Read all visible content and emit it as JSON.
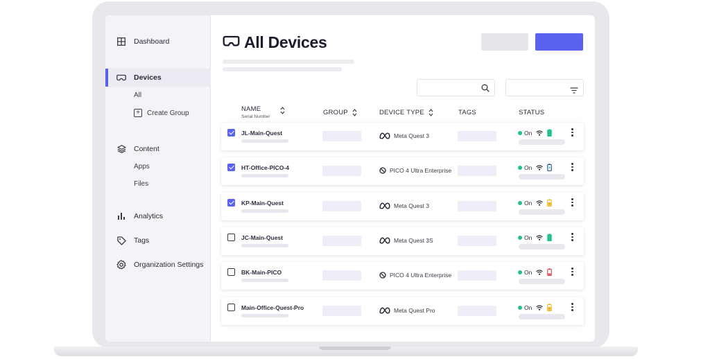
{
  "sidebar": {
    "items": [
      {
        "label": "Dashboard",
        "icon": "grid-icon"
      },
      {
        "label": "Devices",
        "icon": "vr-headset-icon",
        "active": true
      },
      {
        "label": "Content",
        "icon": "layers-icon"
      },
      {
        "label": "Analytics",
        "icon": "bar-chart-icon"
      },
      {
        "label": "Tags",
        "icon": "tag-icon"
      },
      {
        "label": "Organization Settings",
        "icon": "gear-icon"
      }
    ],
    "devices_sub": [
      "All",
      "Create Group"
    ],
    "content_sub": [
      "Apps",
      "Files"
    ]
  },
  "header": {
    "title": "All Devices",
    "title_icon": "vr-headset-icon",
    "accent": "#5a63f0"
  },
  "table": {
    "columns": {
      "name": "NAME",
      "name_sub": "Serial Number",
      "group": "GROUP",
      "device_type": "DEVICE TYPE",
      "tags": "TAGS",
      "status": "STATUS"
    },
    "rows": [
      {
        "name": "JL-Main-Quest",
        "checked": true,
        "device_type": "Meta Quest 3",
        "brand": "meta",
        "status": "On",
        "battery": "green"
      },
      {
        "name": "HT-Office-PICO-4",
        "checked": true,
        "device_type": "PICO 4 Ultra Enterprise",
        "brand": "pico",
        "status": "On",
        "battery": "charging"
      },
      {
        "name": "KP-Main-Quest",
        "checked": true,
        "device_type": "Meta Quest 3",
        "brand": "meta",
        "status": "On",
        "battery": "yellow"
      },
      {
        "name": "JC-Main-Quest",
        "checked": false,
        "device_type": "Meta Quest 3S",
        "brand": "meta",
        "status": "On",
        "battery": "green"
      },
      {
        "name": "BK-Main-PICO",
        "checked": false,
        "device_type": "PICO 4 Ultra Enterprise",
        "brand": "pico",
        "status": "On",
        "battery": "red"
      },
      {
        "name": "Main-Office-Quest-Pro",
        "checked": false,
        "device_type": "Meta Quest Pro",
        "brand": "meta",
        "status": "On",
        "battery": "yellow"
      }
    ]
  },
  "colors": {
    "status_on": "#23c28c",
    "battery_green": "#23c28c",
    "battery_yellow": "#f2b320",
    "battery_red": "#e0393e"
  }
}
